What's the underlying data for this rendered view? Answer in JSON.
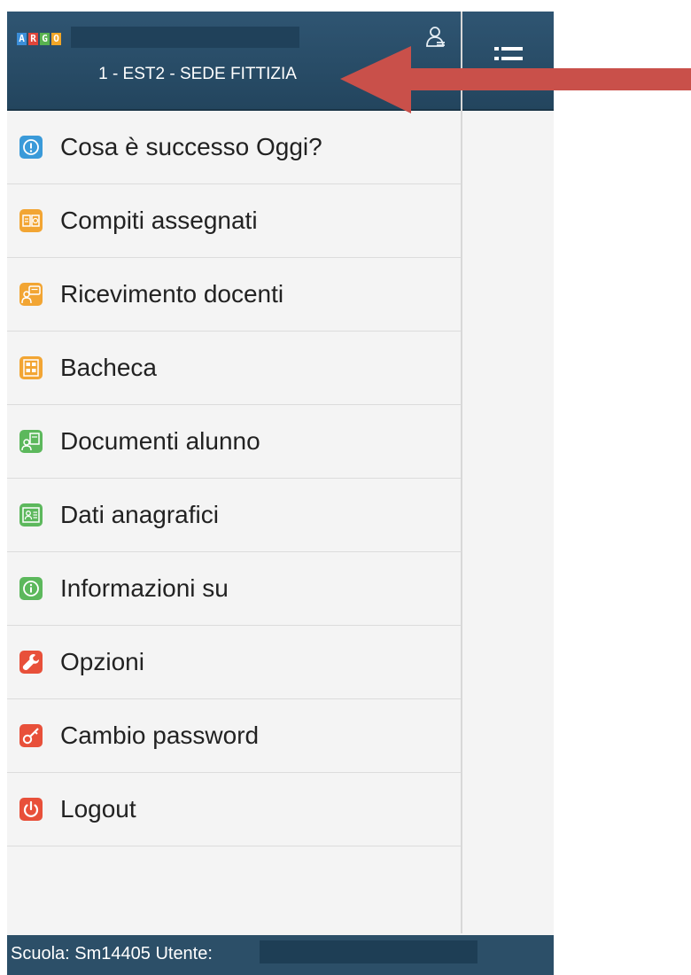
{
  "header": {
    "logo": {
      "letters": [
        "A",
        "R",
        "G",
        "O"
      ],
      "colors": [
        "#3b8ed8",
        "#e0453a",
        "#58b24f",
        "#f2a626"
      ]
    },
    "institution": "1 - EST2 - SEDE FITTIZIA",
    "profile_icon": "profile-icon"
  },
  "toolbar": {
    "menu_icon": "menu-list-icon"
  },
  "menu": {
    "items": [
      {
        "label": "Cosa è successo Oggi?",
        "icon": "alert-circle-icon",
        "color": "#3a9ad9"
      },
      {
        "label": "Compiti assegnati",
        "icon": "homework-book-icon",
        "color": "#f2a533"
      },
      {
        "label": "Ricevimento docenti",
        "icon": "teacher-meeting-icon",
        "color": "#f2a533"
      },
      {
        "label": "Bacheca",
        "icon": "bulletin-board-icon",
        "color": "#f2a533"
      },
      {
        "label": "Documenti alunno",
        "icon": "student-documents-icon",
        "color": "#5cb85c"
      },
      {
        "label": "Dati anagrafici",
        "icon": "id-card-icon",
        "color": "#5cb85c"
      },
      {
        "label": "Informazioni su",
        "icon": "info-icon",
        "color": "#5cb85c"
      },
      {
        "label": "Opzioni",
        "icon": "wrench-icon",
        "color": "#e8503a"
      },
      {
        "label": "Cambio password",
        "icon": "key-icon",
        "color": "#e8503a"
      },
      {
        "label": "Logout",
        "icon": "power-icon",
        "color": "#e8503a"
      }
    ]
  },
  "footer": {
    "text": "Scuola: Sm14405 Utente:"
  },
  "annotation": {
    "arrow_color": "#c9504a"
  }
}
